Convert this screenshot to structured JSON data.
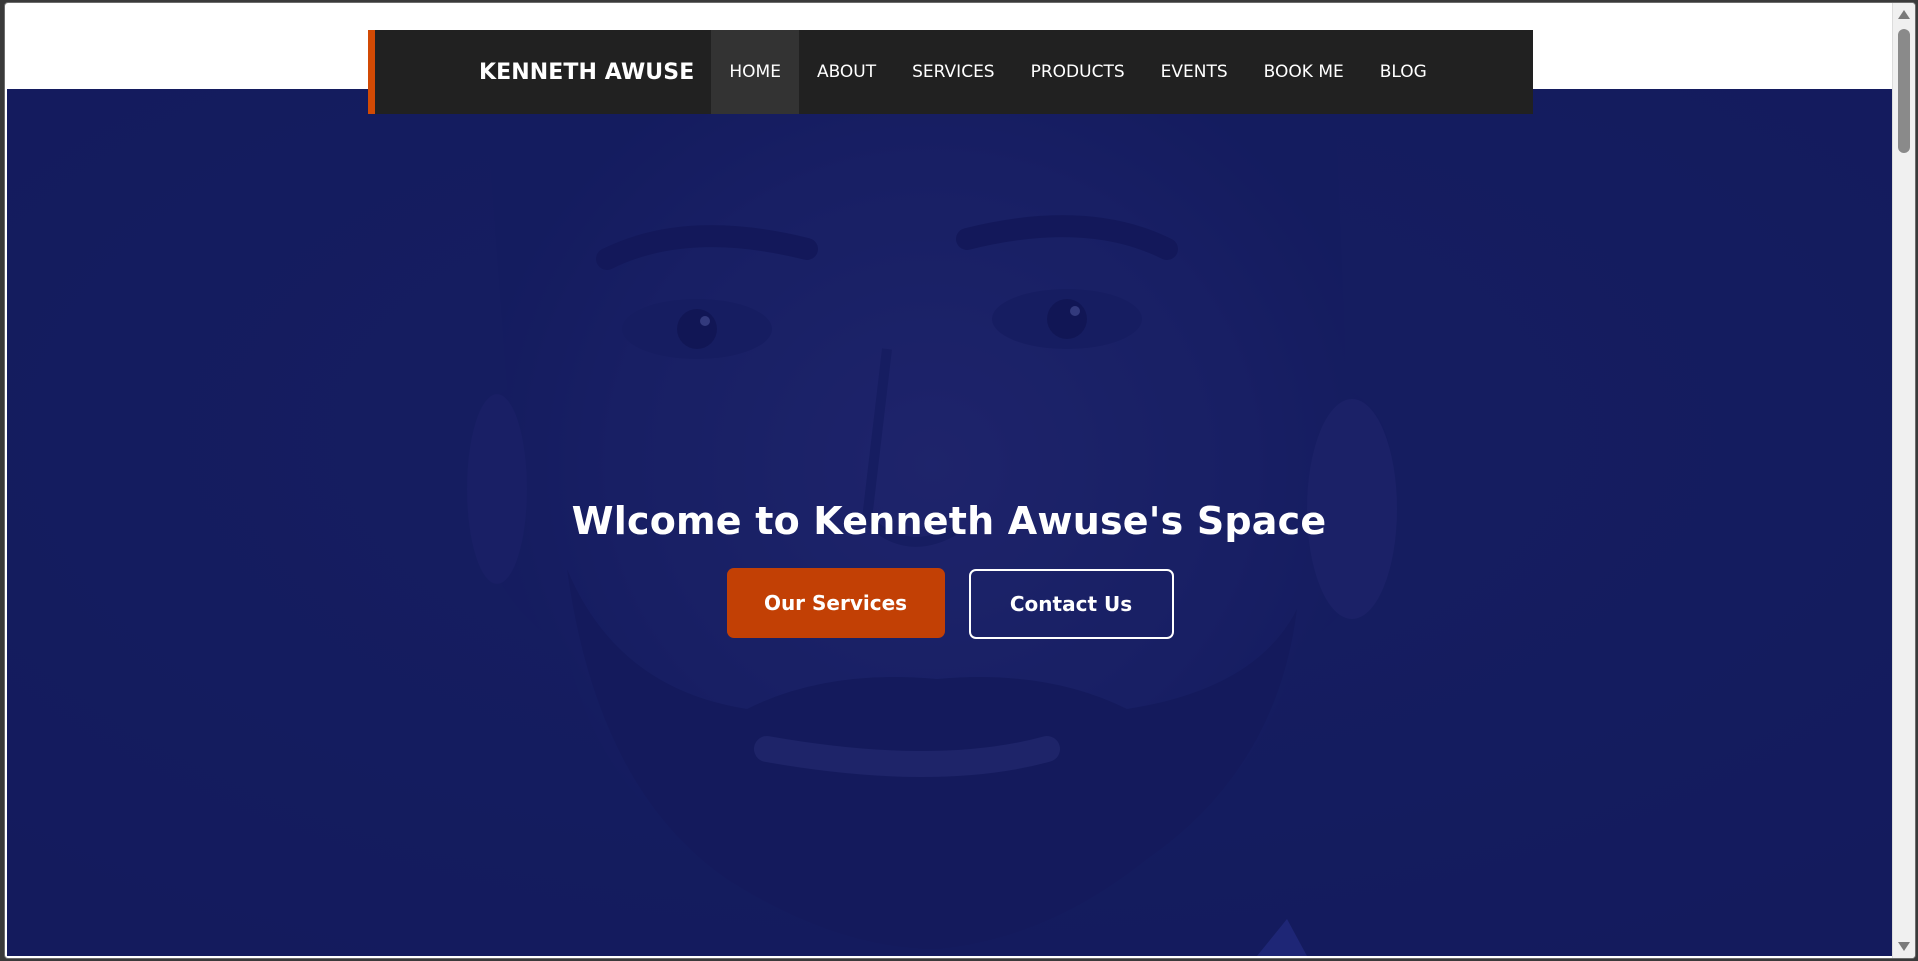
{
  "navbar": {
    "brand": "KENNETH AWUSE",
    "items": [
      {
        "label": "HOME",
        "active": true
      },
      {
        "label": "ABOUT",
        "active": false
      },
      {
        "label": "SERVICES",
        "active": false
      },
      {
        "label": "PRODUCTS",
        "active": false
      },
      {
        "label": "EVENTS",
        "active": false
      },
      {
        "label": "BOOK ME",
        "active": false
      },
      {
        "label": "BLOG",
        "active": false
      }
    ]
  },
  "hero": {
    "title": "Wlcome to Kenneth Awuse's Space",
    "primary_button": "Our Services",
    "secondary_button": "Contact Us"
  },
  "colors": {
    "accent": "#c24005",
    "navbar_bg": "#212121",
    "hero_overlay": "#151d5c"
  }
}
